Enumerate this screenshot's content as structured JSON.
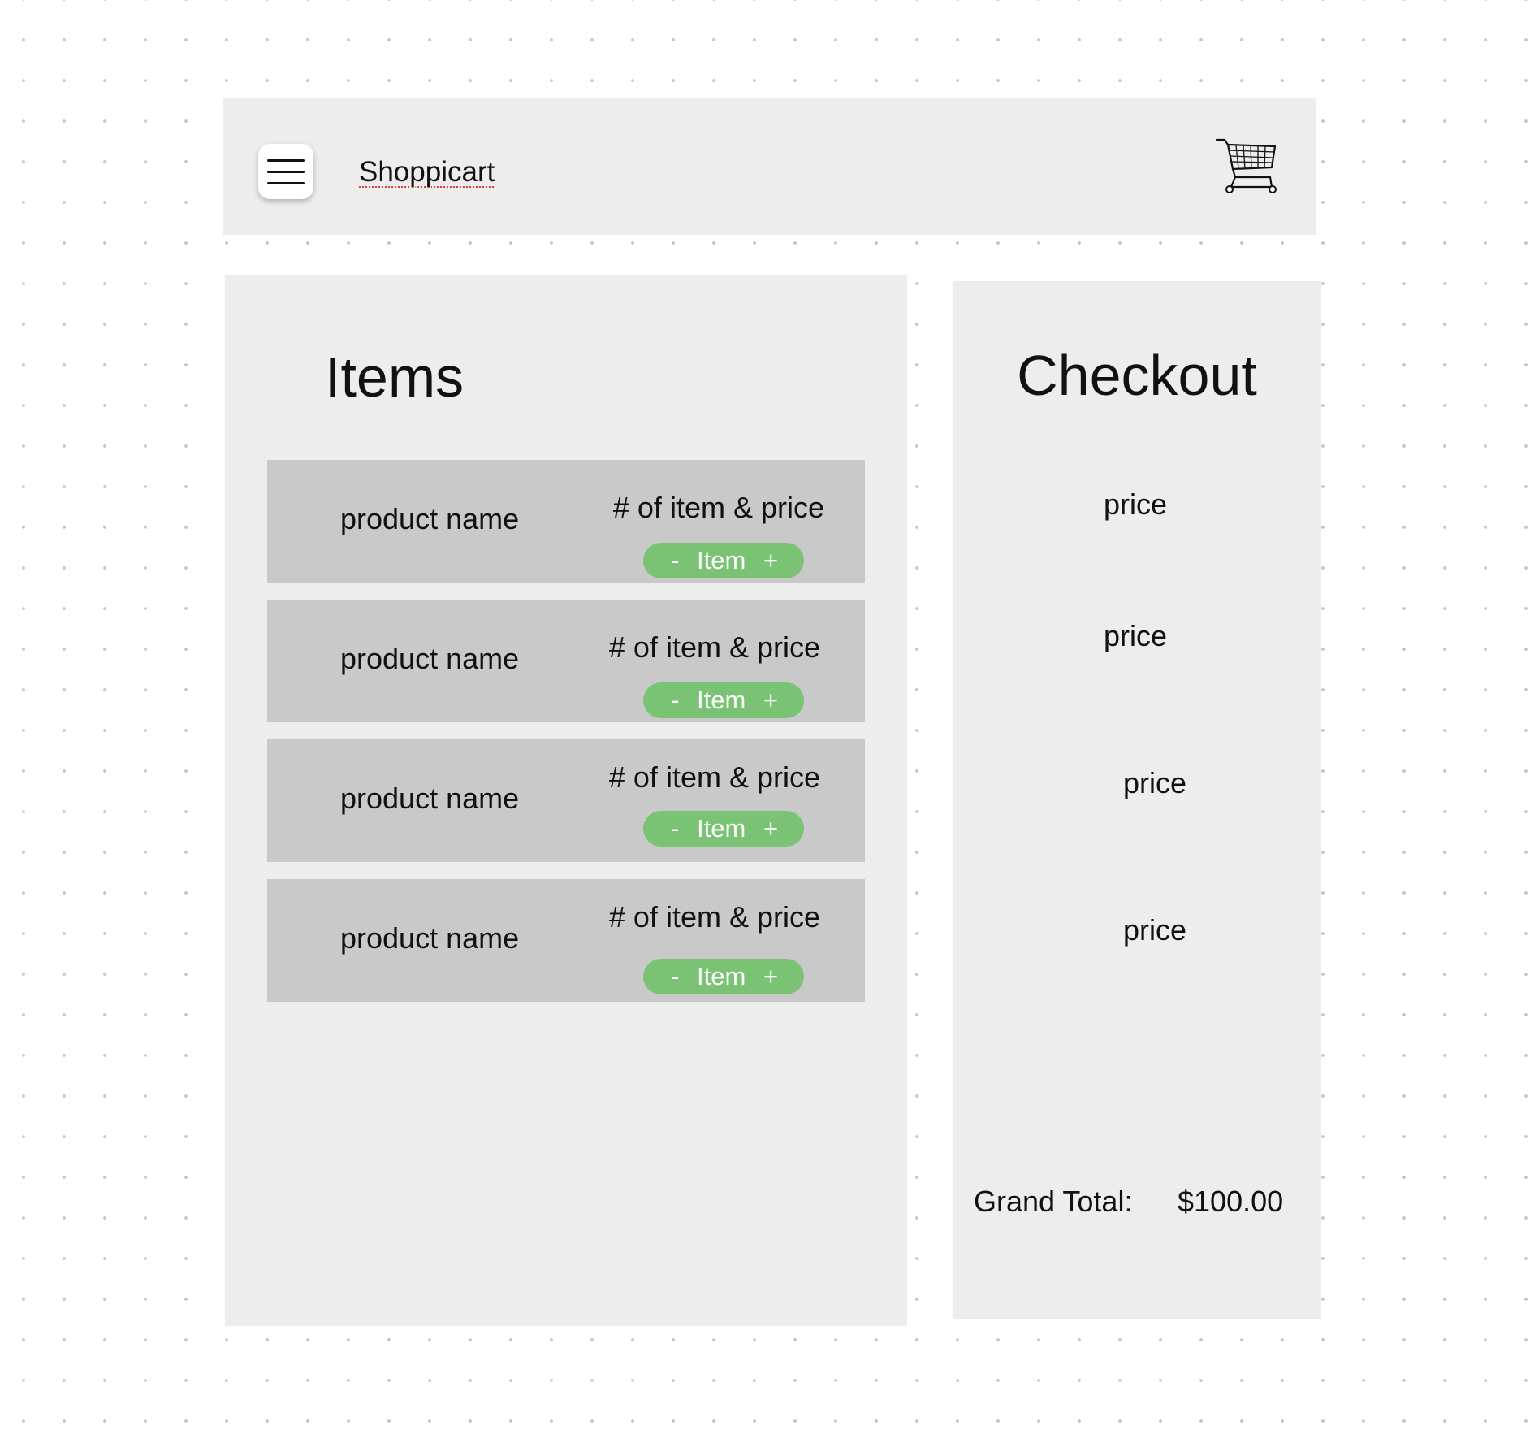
{
  "header": {
    "menu_icon": "hamburger-menu-icon",
    "app_title": "Shoppicart",
    "cart_icon": "shopping-cart-icon"
  },
  "items_panel": {
    "title": "Items",
    "items": [
      {
        "product_name": "product name",
        "price_text": "# of item & price",
        "stepper": {
          "minus": "-",
          "label": "Item",
          "plus": "+"
        }
      },
      {
        "product_name": "product name",
        "price_text": "# of item & price",
        "stepper": {
          "minus": "-",
          "label": "Item",
          "plus": "+"
        }
      },
      {
        "product_name": "product name",
        "price_text": "# of item & price",
        "stepper": {
          "minus": "-",
          "label": "Item",
          "plus": "+"
        }
      },
      {
        "product_name": "product name",
        "price_text": "# of item & price",
        "stepper": {
          "minus": "-",
          "label": "Item",
          "plus": "+"
        }
      }
    ]
  },
  "checkout_panel": {
    "title": "Checkout",
    "prices": [
      "price",
      "price",
      "price",
      "price"
    ],
    "grand_total_label": "Grand Total:",
    "grand_total_value": "$100.00"
  },
  "colors": {
    "panel_background": "#ededed",
    "item_row_background": "#c9c9c9",
    "stepper_green": "#7ac374"
  }
}
